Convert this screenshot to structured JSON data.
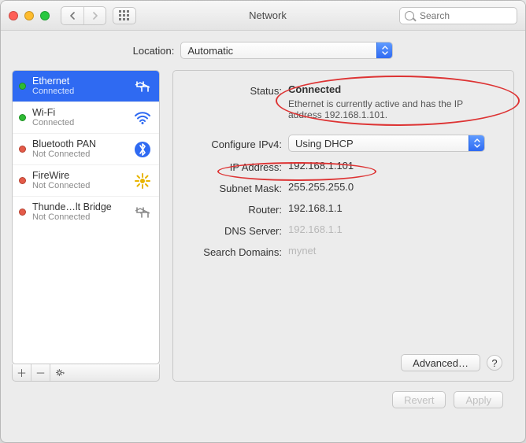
{
  "window": {
    "title": "Network",
    "search_placeholder": "Search"
  },
  "location": {
    "label": "Location:",
    "value": "Automatic"
  },
  "sidebar": {
    "items": [
      {
        "name": "Ethernet",
        "sub": "Connected",
        "status": "green",
        "icon": "ethernet-icon",
        "selected": true
      },
      {
        "name": "Wi-Fi",
        "sub": "Connected",
        "status": "green",
        "icon": "wifi-icon",
        "selected": false
      },
      {
        "name": "Bluetooth PAN",
        "sub": "Not Connected",
        "status": "red",
        "icon": "bluetooth-icon",
        "selected": false
      },
      {
        "name": "FireWire",
        "sub": "Not Connected",
        "status": "red",
        "icon": "firewire-icon",
        "selected": false
      },
      {
        "name": "Thunde…lt Bridge",
        "sub": "Not Connected",
        "status": "red",
        "icon": "ethernet-icon",
        "selected": false
      }
    ]
  },
  "panel": {
    "status_label": "Status:",
    "status_value": "Connected",
    "status_desc": "Ethernet is currently active and has the IP address 192.168.1.101.",
    "configure_label": "Configure IPv4:",
    "configure_value": "Using DHCP",
    "ip_label": "IP Address:",
    "ip_value": "192.168.1.101",
    "subnet_label": "Subnet Mask:",
    "subnet_value": "255.255.255.0",
    "router_label": "Router:",
    "router_value": "192.168.1.1",
    "dns_label": "DNS Server:",
    "dns_value": "192.168.1.1",
    "search_label": "Search Domains:",
    "search_value": "mynet",
    "advanced": "Advanced…",
    "help": "?"
  },
  "footer": {
    "revert": "Revert",
    "apply": "Apply"
  }
}
